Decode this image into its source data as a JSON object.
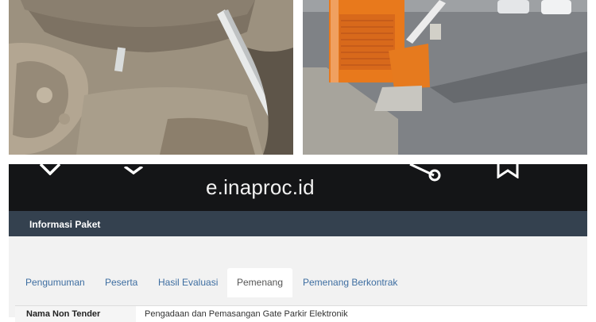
{
  "photos": {
    "left": {
      "subject": "broken concrete base with bent metal pole"
    },
    "right": {
      "subject": "damaged orange parking gate ticket machine and barrier"
    }
  },
  "browser": {
    "url": "e.inaproc.id",
    "icons": [
      "close-icon",
      "chevron-down-icon",
      "share-icon",
      "bookmark-icon"
    ]
  },
  "nav": {
    "title": "Informasi Paket"
  },
  "tabs": [
    {
      "label": "Pengumuman",
      "active": false
    },
    {
      "label": "Peserta",
      "active": false
    },
    {
      "label": "Hasil Evaluasi",
      "active": false
    },
    {
      "label": "Pemenang",
      "active": true
    },
    {
      "label": "Pemenang Berkontrak",
      "active": false
    }
  ],
  "detail": {
    "label": "Nama Non Tender",
    "value": "Pengadaan dan Pemasangan Gate Parkir Elektronik"
  },
  "colors": {
    "bar_bg": "#141517",
    "nav_bg": "#34414f",
    "tab_link": "#3e6ea1",
    "content_bg": "#f2f2f2"
  }
}
